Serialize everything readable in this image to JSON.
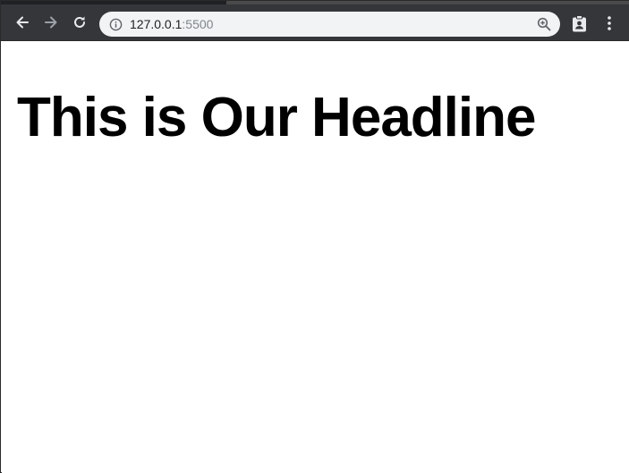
{
  "browser": {
    "url_host": "127.0.0.1",
    "url_port": ":5500"
  },
  "page": {
    "headline": "This is Our Headline"
  },
  "colors": {
    "toolbar": "#35363a",
    "omnibox": "#f1f3f4",
    "page_background": "#ffffff",
    "headline": "#000000"
  },
  "icons": {
    "back": "arrow-left",
    "forward": "arrow-right",
    "reload": "reload",
    "info": "info-circle",
    "zoom": "magnifier-plus",
    "extension": "contact-badge",
    "menu": "vertical-dots"
  }
}
